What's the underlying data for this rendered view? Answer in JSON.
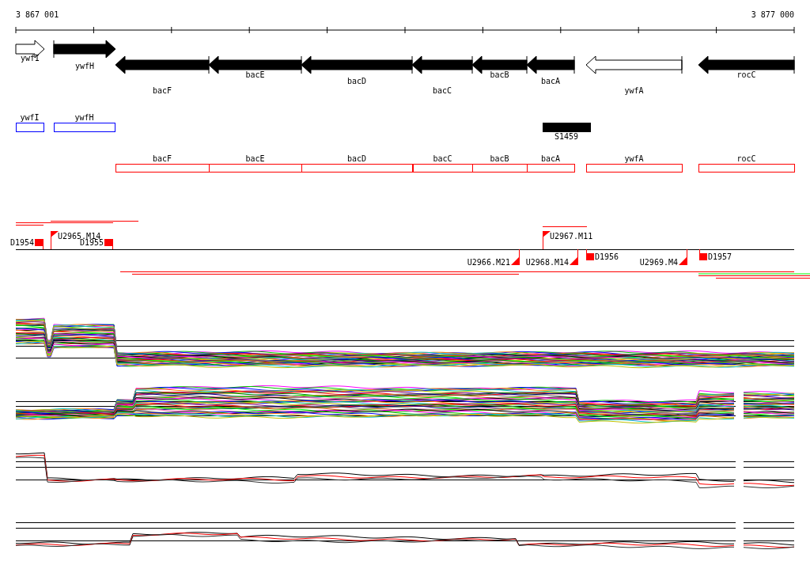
{
  "ruler": {
    "start": "3 867 001",
    "end": "3 877 000"
  },
  "genes": [
    {
      "name": "ywfI",
      "forward": true,
      "filled": false
    },
    {
      "name": "ywfH",
      "forward": true,
      "filled": true
    },
    {
      "name": "bacF",
      "forward": false,
      "filled": true
    },
    {
      "name": "bacE",
      "forward": false,
      "filled": true
    },
    {
      "name": "bacD",
      "forward": false,
      "filled": true
    },
    {
      "name": "bacC",
      "forward": false,
      "filled": true
    },
    {
      "name": "bacB",
      "forward": false,
      "filled": true
    },
    {
      "name": "bacA",
      "forward": false,
      "filled": true
    },
    {
      "name": "ywfA",
      "forward": false,
      "filled": false
    },
    {
      "name": "rocC",
      "forward": false,
      "filled": true
    }
  ],
  "blue_features": [
    {
      "name": "ywfI"
    },
    {
      "name": "ywfH"
    }
  ],
  "elements": [
    {
      "name": "S1459"
    }
  ],
  "red_features": [
    {
      "name": "bacF"
    },
    {
      "name": "bacE"
    },
    {
      "name": "bacD"
    },
    {
      "name": "bacC"
    },
    {
      "name": "bacB"
    },
    {
      "name": "bacA"
    },
    {
      "name": "ywfA"
    },
    {
      "name": "rocC"
    }
  ],
  "markers": [
    {
      "label": "D1954",
      "kind": "block",
      "above": true
    },
    {
      "label": "U2965.M14",
      "kind": "flag",
      "above": true
    },
    {
      "label": "D1955",
      "kind": "block",
      "above": true
    },
    {
      "label": "U2967.M11",
      "kind": "flag",
      "above": true
    },
    {
      "label": "U2966.M21",
      "kind": "flag",
      "above": false
    },
    {
      "label": "U2968.M14",
      "kind": "flag",
      "above": false
    },
    {
      "label": "D1956",
      "kind": "block",
      "above": false
    },
    {
      "label": "U2969.M4",
      "kind": "flag",
      "above": false
    },
    {
      "label": "D1957",
      "kind": "block",
      "above": false
    }
  ]
}
